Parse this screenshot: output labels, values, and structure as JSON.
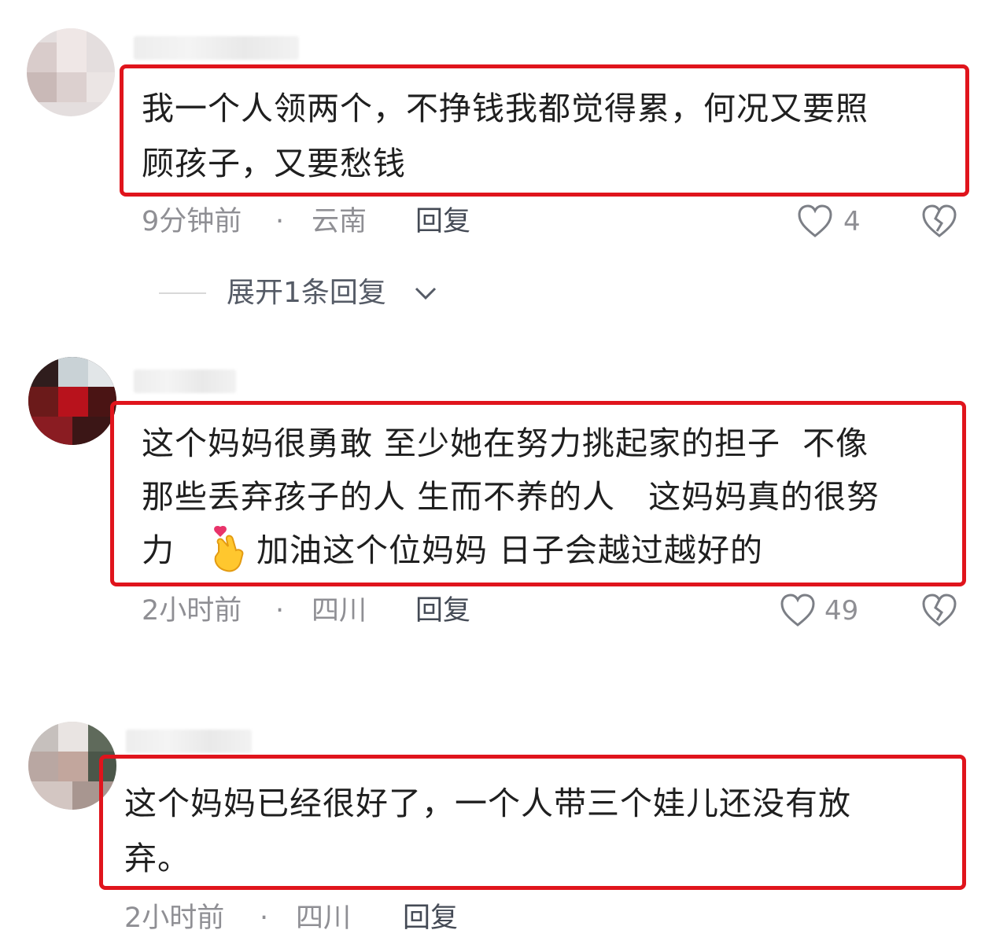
{
  "comments": [
    {
      "text_lines": [
        "我一个人领两个，不挣钱我都觉得累，何况又要照",
        "顾孩子，又要愁钱"
      ],
      "time": "9分钟前",
      "dot": "·",
      "location": "云南",
      "reply": "回复",
      "likes": "4",
      "expand": "展开1条回复"
    },
    {
      "text_lines": [
        "这个妈妈很勇敢 至少她在努力挑起家的担子  不像",
        "那些丢弃孩子的人 生而不养的人   这妈妈真的很努",
        "力  ",
        "加油这个位妈妈 日子会越过越好的"
      ],
      "time": "2小时前",
      "dot": "·",
      "location": "四川",
      "reply": "回复",
      "likes": "49"
    },
    {
      "text_lines": [
        "这个妈妈已经很好了，一个人带三个娃儿还没有放",
        "弃。"
      ],
      "time": "2小时前",
      "dot": "·",
      "location": "四川",
      "reply": "回复"
    }
  ],
  "icons": {
    "like": "heart-outline-icon",
    "dislike": "broken-heart-icon",
    "expand": "chevron-down-icon",
    "emoji": "finger-heart-emoji"
  },
  "colors": {
    "highlight": "#e0141c",
    "meta": "#8f8f94"
  }
}
